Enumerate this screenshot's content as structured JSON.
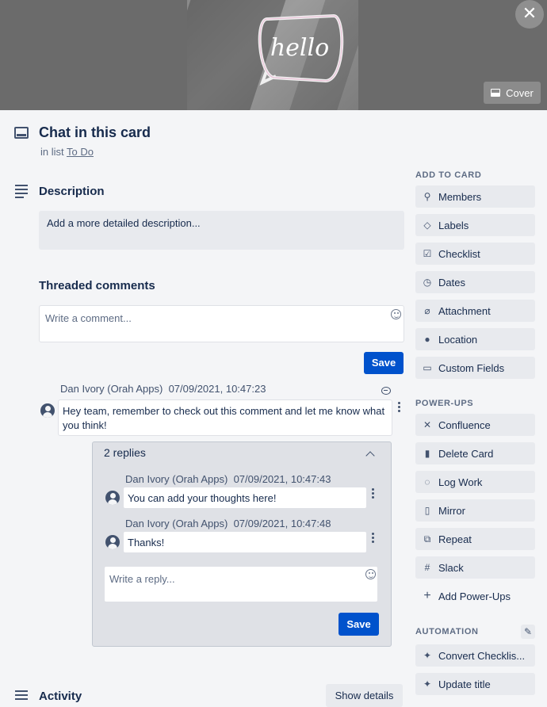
{
  "cover": {
    "neon_text": "hello",
    "cover_button": "Cover",
    "close_glyph": "✕"
  },
  "card": {
    "title": "Chat in this card",
    "in_list_prefix": "in list",
    "list_name": "To Do"
  },
  "description": {
    "heading": "Description",
    "placeholder": "Add a more detailed description..."
  },
  "comments": {
    "heading": "Threaded comments",
    "input_placeholder": "Write a comment...",
    "save_label": "Save",
    "items": [
      {
        "author": "Dan Ivory (Orah Apps)",
        "timestamp": "07/09/2021, 10:47:23",
        "text": "Hey team, remember to check out this comment and let me know what you think!"
      }
    ]
  },
  "replies": {
    "count_label": "2 replies",
    "items": [
      {
        "author": "Dan Ivory (Orah Apps)",
        "timestamp": "07/09/2021, 10:47:43",
        "text": "You can add your thoughts here!"
      },
      {
        "author": "Dan Ivory (Orah Apps)",
        "timestamp": "07/09/2021, 10:47:48",
        "text": "Thanks!"
      }
    ],
    "input_placeholder": "Write a reply...",
    "save_label": "Save"
  },
  "activity": {
    "heading": "Activity",
    "show_details": "Show details"
  },
  "sidebar": {
    "add_to_card": {
      "heading": "ADD TO CARD",
      "items": [
        "Members",
        "Labels",
        "Checklist",
        "Dates",
        "Attachment",
        "Location",
        "Custom Fields"
      ]
    },
    "power_ups": {
      "heading": "POWER-UPS",
      "items": [
        "Confluence",
        "Delete Card",
        "Log Work",
        "Mirror",
        "Repeat",
        "Slack"
      ],
      "add_label": "Add Power-Ups"
    },
    "automation": {
      "heading": "AUTOMATION",
      "items": [
        "Convert Checklis...",
        "Update title"
      ]
    }
  },
  "colors": {
    "primary": "#0052cc",
    "text": "#172b4d",
    "subtle": "#5e6c84",
    "background": "#f4f5f7"
  }
}
